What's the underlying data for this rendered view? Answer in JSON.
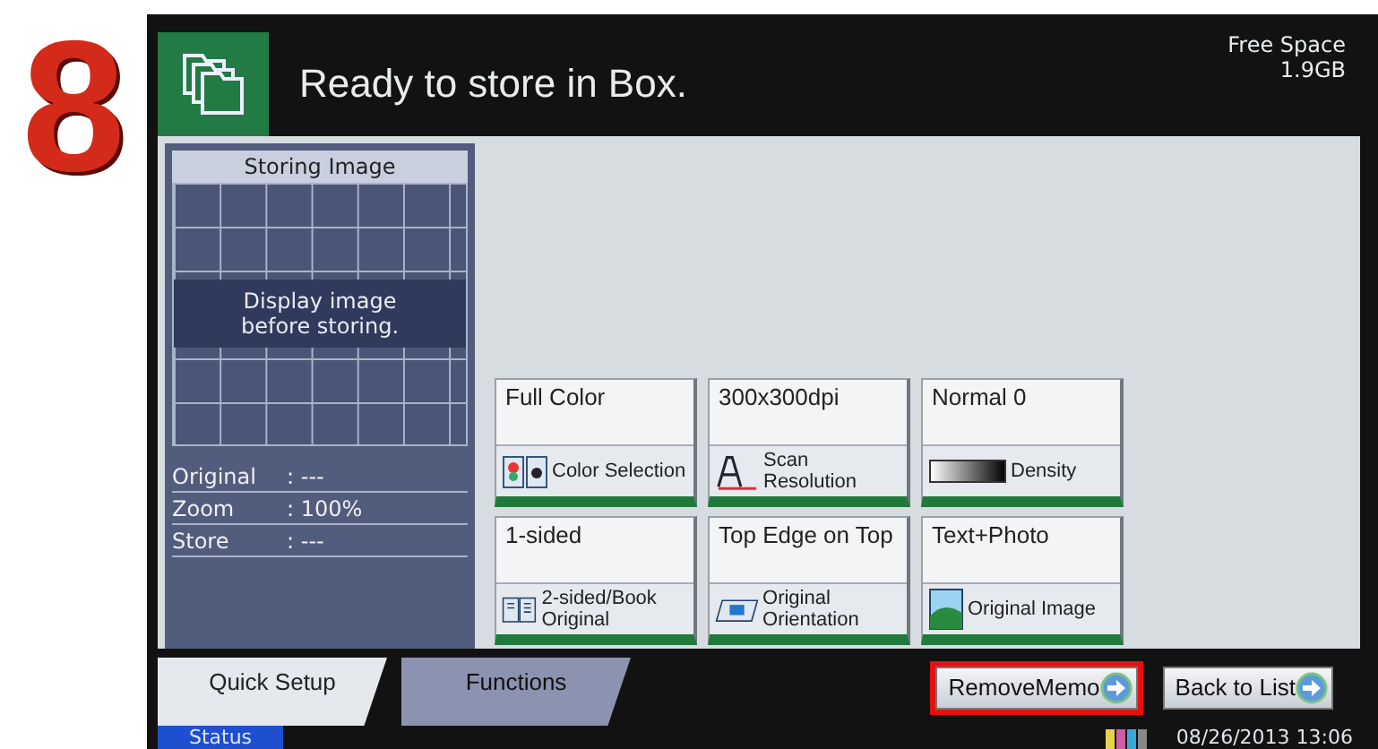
{
  "step": "8",
  "header": {
    "title": "Ready to store in Box.",
    "free_space_label": "Free Space",
    "free_space_value": "1.9GB"
  },
  "preview": {
    "title": "Storing Image",
    "message": "Display image before storing."
  },
  "info": [
    {
      "label": "Original",
      "value": ": ---"
    },
    {
      "label": "Zoom",
      "value": ": 100%"
    },
    {
      "label": "Store",
      "value": ": ---"
    }
  ],
  "settings": [
    {
      "current": "Full Color",
      "caption": "Color Selection",
      "kind": "color"
    },
    {
      "current": "300x300dpi",
      "caption": "Scan Resolution",
      "kind": "resolution"
    },
    {
      "current": "Normal 0",
      "caption": "Density",
      "kind": "density"
    },
    {
      "current": "1-sided",
      "caption": "2-sided/Book Original",
      "kind": "sided"
    },
    {
      "current": "Top Edge on Top",
      "caption": "Original Orientation",
      "kind": "orientation"
    },
    {
      "current": "Text+Photo",
      "caption": "Original Image",
      "kind": "image"
    }
  ],
  "tabs": [
    {
      "label": "Quick Setup",
      "selected": true
    },
    {
      "label": "Functions",
      "selected": false
    }
  ],
  "buttons": [
    {
      "label": "RemoveMemo",
      "highlighted": true
    },
    {
      "label": "Back to List",
      "highlighted": false
    }
  ],
  "status_bar": {
    "status": "Status",
    "datetime": "08/26/2013 13:06"
  }
}
